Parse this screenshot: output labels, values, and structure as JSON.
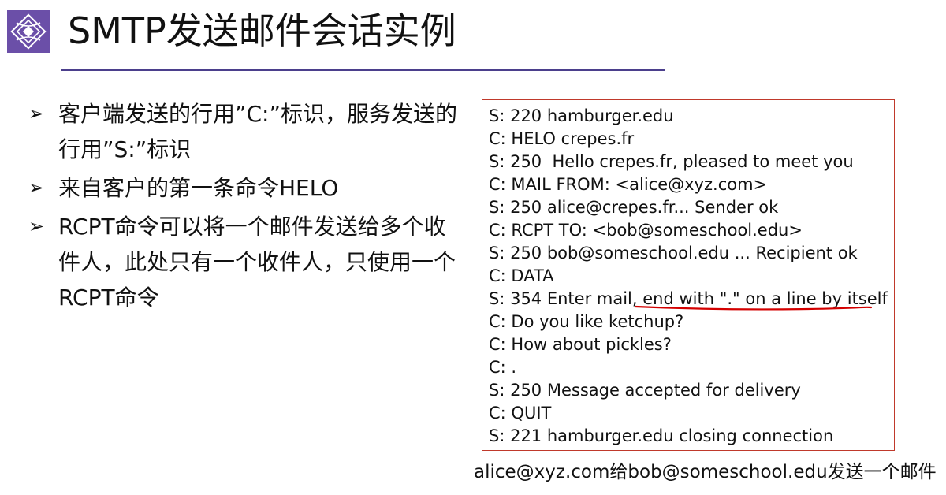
{
  "header": {
    "title": "SMTP发送邮件会话实例",
    "logo_icon": "university-seal-icon",
    "accent_color": "#6b4fa8",
    "rule_color": "#4b3f8c"
  },
  "bullets": [
    {
      "marker": "➢",
      "text": "客户端发送的行用”C:”标识，服务发送的行用”S:”标识"
    },
    {
      "marker": "➢",
      "text": "来自客户的第一条命令HELO"
    },
    {
      "marker": "➢",
      "text": "RCPT命令可以将一个邮件发送给多个收件人，此处只有一个收件人，只使用一个RCPT命令"
    }
  ],
  "session": {
    "border_color": "#c0392b",
    "highlight_color": "#d40000",
    "lines": [
      "S: 220 hamburger.edu",
      "C: HELO crepes.fr",
      "S: 250  Hello crepes.fr, pleased to meet you",
      "C: MAIL FROM: <alice@xyz.com>",
      "S: 250 alice@crepes.fr... Sender ok",
      "C: RCPT TO: <bob@someschool.edu>",
      "S: 250 bob@someschool.edu ... Recipient ok",
      "C: DATA",
      "S: 354 Enter mail, end with \".\" on a line by itself",
      "C: Do you like ketchup?",
      "C: How about pickles?",
      "C: .",
      "S: 250 Message accepted for delivery",
      "C: QUIT",
      "S: 221 hamburger.edu closing connection"
    ]
  },
  "caption": "alice@xyz.com给bob@someschool.edu发送一个邮件"
}
